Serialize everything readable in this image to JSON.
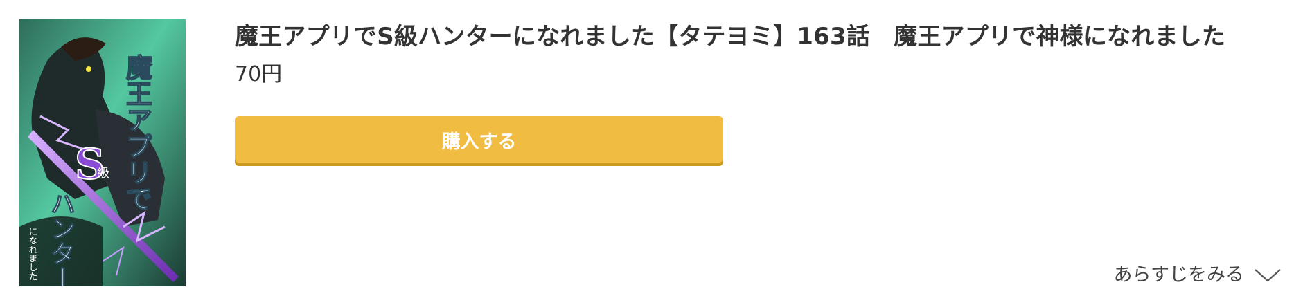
{
  "product": {
    "title": "魔王アプリでS級ハンターになれました【タテヨミ】163話　魔王アプリで神様になれました",
    "price": "70円",
    "buy_label": "購入する",
    "synopsis_label": "あらすじをみる",
    "cover": {
      "title_text": "魔王アプリで",
      "s_text": "S",
      "kyu_text": "級",
      "hunter_text": "ハンター",
      "sub_text": "になれました"
    }
  },
  "icons": {
    "synopsis_toggle": "chevron-down-icon"
  },
  "colors": {
    "button": "#f0bc42",
    "button_shadow": "#c99a1f",
    "text": "#333333",
    "cover_green": "#3fb58f"
  }
}
